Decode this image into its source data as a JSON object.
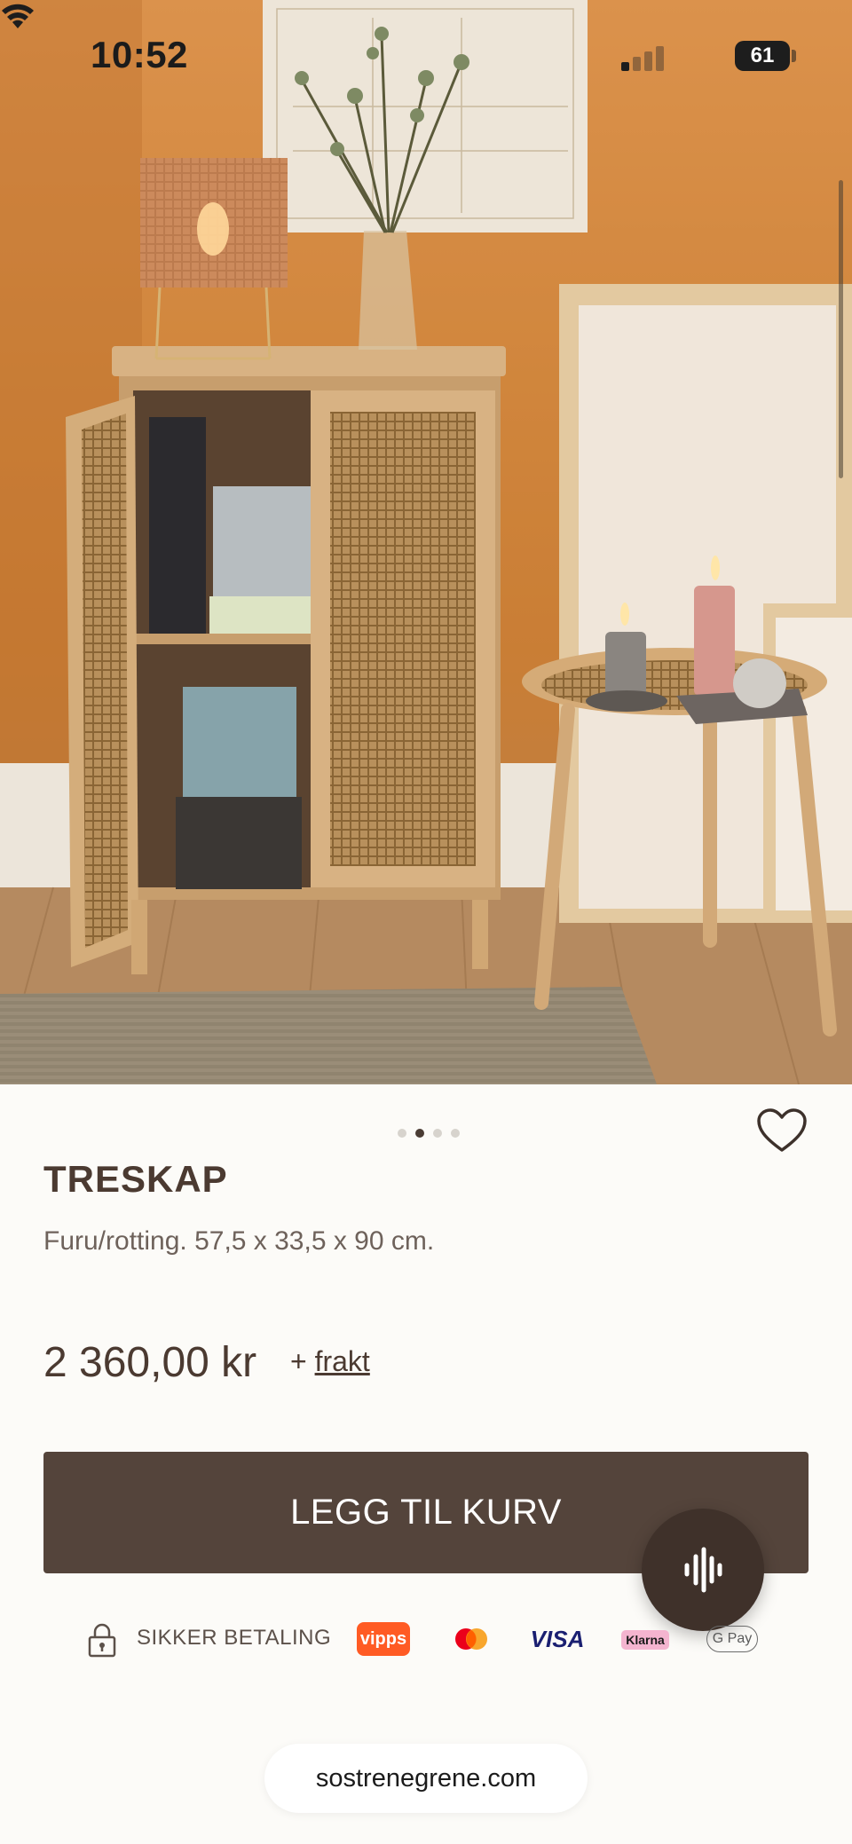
{
  "status_bar": {
    "time": "10:52",
    "battery": "61"
  },
  "product": {
    "title": "TRESKAP",
    "description": "Furu/rotting. 57,5 x 33,5 x 90 cm.",
    "price": "2 360,00 kr",
    "shipping_prefix": "+ ",
    "shipping_link": "frakt",
    "image_count": 4,
    "active_image_index": 1
  },
  "actions": {
    "add_to_cart": "LEGG TIL KURV"
  },
  "payment": {
    "secure_label": "SIKKER BETALING",
    "methods": {
      "vipps": "vipps",
      "visa": "VISA",
      "klarna": "Klarna",
      "gpay": "G Pay"
    }
  },
  "browser": {
    "url": "sostrenegrene.com"
  },
  "colors": {
    "accent_brown": "#54443b",
    "text": "#4b3a31",
    "background": "#fcfbf8"
  }
}
